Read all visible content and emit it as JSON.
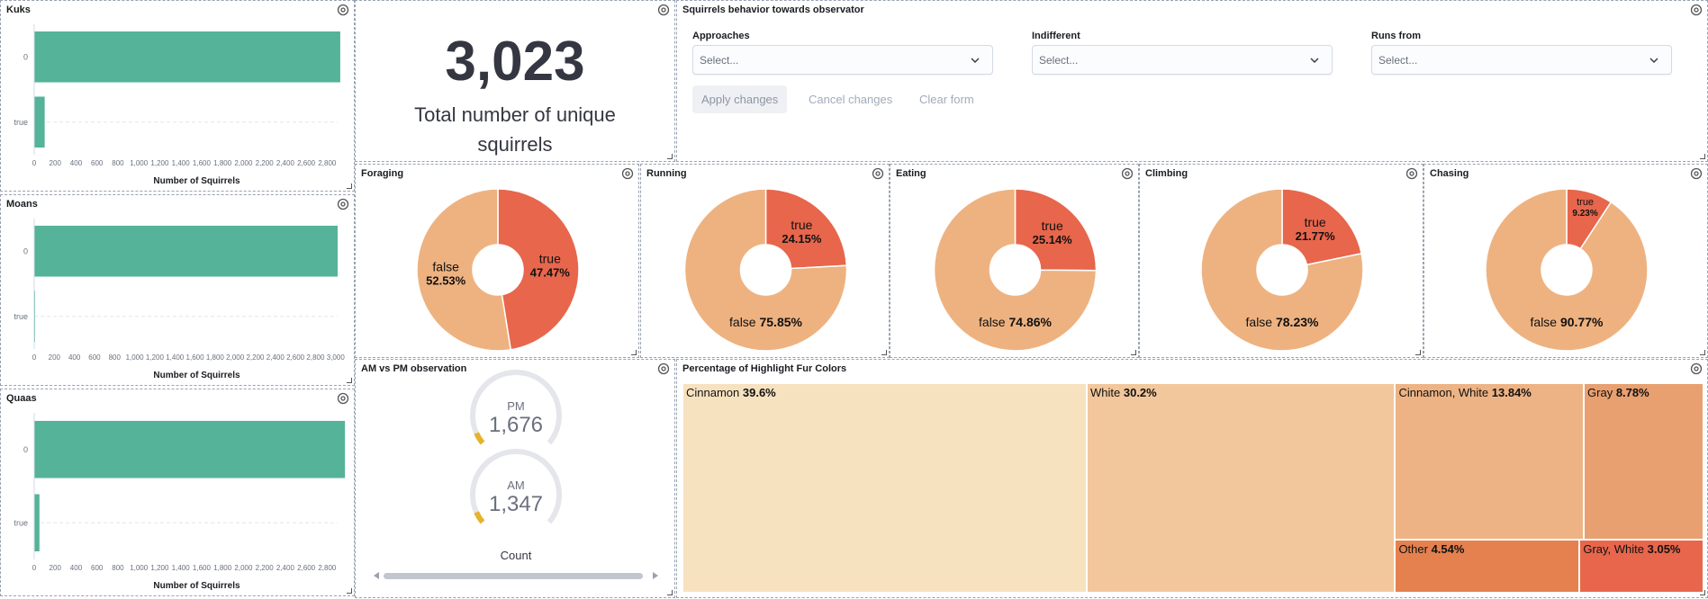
{
  "panels": {
    "kuks": {
      "title": "Kuks",
      "xlabel": "Number of Squirrels",
      "categories": [
        "0",
        "true"
      ],
      "values": [
        2925,
        100
      ],
      "ticks": [
        "0",
        "200",
        "400",
        "600",
        "800",
        "1,000",
        "1,200",
        "1,400",
        "1,600",
        "1,800",
        "2,000",
        "2,200",
        "2,400",
        "2,600",
        "2,800"
      ],
      "xmax": 2900
    },
    "moans": {
      "title": "Moans",
      "xlabel": "Number of Squirrels",
      "categories": [
        "0",
        "true"
      ],
      "values": [
        3020,
        3
      ],
      "ticks": [
        "0",
        "200",
        "400",
        "600",
        "800",
        "1,000",
        "1,200",
        "1,400",
        "1,600",
        "1,800",
        "2,000",
        "2,200",
        "2,400",
        "2,600",
        "2,800",
        "3,000"
      ],
      "xmax": 3020
    },
    "quaas": {
      "title": "Quaas",
      "xlabel": "Number of Squirrels",
      "categories": [
        "0",
        "true"
      ],
      "values": [
        2970,
        50
      ],
      "ticks": [
        "0",
        "200",
        "400",
        "600",
        "800",
        "1,000",
        "1,200",
        "1,400",
        "1,600",
        "1,800",
        "2,000",
        "2,200",
        "2,400",
        "2,600",
        "2,800"
      ],
      "xmax": 2900
    },
    "metric": {
      "value": "3,023",
      "label": "Total number of unique squirrels"
    },
    "behavior": {
      "title": "Squirrels behavior towards observator",
      "controls": [
        {
          "label": "Approaches",
          "placeholder": "Select..."
        },
        {
          "label": "Indifferent",
          "placeholder": "Select..."
        },
        {
          "label": "Runs from",
          "placeholder": "Select..."
        }
      ],
      "apply_label": "Apply changes",
      "cancel_label": "Cancel changes",
      "clear_label": "Clear form"
    },
    "ampm": {
      "title": "AM vs PM observation",
      "gauges": [
        {
          "label": "PM",
          "value": "1,676",
          "fraction": 0.06
        },
        {
          "label": "AM",
          "value": "1,347",
          "fraction": 0.06
        }
      ],
      "footer": "Count"
    },
    "fur": {
      "title": "Percentage of Highlight Fur Colors"
    }
  },
  "chart_data": [
    {
      "type": "bar",
      "title": "Kuks",
      "categories": [
        "0",
        "true"
      ],
      "values": [
        2925,
        100
      ],
      "xlabel": "Number of Squirrels"
    },
    {
      "type": "bar",
      "title": "Moans",
      "categories": [
        "0",
        "true"
      ],
      "values": [
        3020,
        3
      ],
      "xlabel": "Number of Squirrels"
    },
    {
      "type": "bar",
      "title": "Quaas",
      "categories": [
        "0",
        "true"
      ],
      "values": [
        2970,
        50
      ],
      "xlabel": "Number of Squirrels"
    },
    {
      "type": "pie",
      "title": "Foraging",
      "slices": [
        {
          "label": "true",
          "pct": "47.47%",
          "value": 47.47
        },
        {
          "label": "false",
          "pct": "52.53%",
          "value": 52.53
        }
      ]
    },
    {
      "type": "pie",
      "title": "Running",
      "slices": [
        {
          "label": "true",
          "pct": "24.15%",
          "value": 24.15
        },
        {
          "label": "false",
          "pct": "75.85%",
          "value": 75.85
        }
      ]
    },
    {
      "type": "pie",
      "title": "Eating",
      "slices": [
        {
          "label": "true",
          "pct": "25.14%",
          "value": 25.14
        },
        {
          "label": "false",
          "pct": "74.86%",
          "value": 74.86
        }
      ]
    },
    {
      "type": "pie",
      "title": "Climbing",
      "slices": [
        {
          "label": "true",
          "pct": "21.77%",
          "value": 21.77
        },
        {
          "label": "false",
          "pct": "78.23%",
          "value": 78.23
        }
      ]
    },
    {
      "type": "pie",
      "title": "Chasing",
      "slices": [
        {
          "label": "true",
          "pct": "9.23%",
          "value": 9.23
        },
        {
          "label": "false",
          "pct": "90.77%",
          "value": 90.77
        }
      ]
    },
    {
      "type": "heatmap",
      "title": "Percentage of Highlight Fur Colors",
      "cells": [
        {
          "label": "Cinnamon",
          "pct": "39.6%",
          "value": 39.6
        },
        {
          "label": "White",
          "pct": "30.2%",
          "value": 30.2
        },
        {
          "label": "Cinnamon, White",
          "pct": "13.84%",
          "value": 13.84
        },
        {
          "label": "Gray",
          "pct": "8.78%",
          "value": 8.78
        },
        {
          "label": "Other",
          "pct": "4.54%",
          "value": 4.54
        },
        {
          "label": "Gray, White",
          "pct": "3.05%",
          "value": 3.05
        }
      ]
    }
  ],
  "colors": {
    "bar": "#54b399",
    "pie_true": "#e7664c",
    "pie_false": "#eeb280",
    "gauge": "#e7b32c",
    "gauge_track": "#e4e6eb",
    "treemap": [
      "#f7e2c0",
      "#f2c79b",
      "#edb384",
      "#e8a070",
      "#e5814f",
      "#e7664c"
    ]
  },
  "icons": {
    "gear": "gear-icon",
    "chevron": "chevron-down-icon",
    "resize": "resize-handle-icon"
  }
}
